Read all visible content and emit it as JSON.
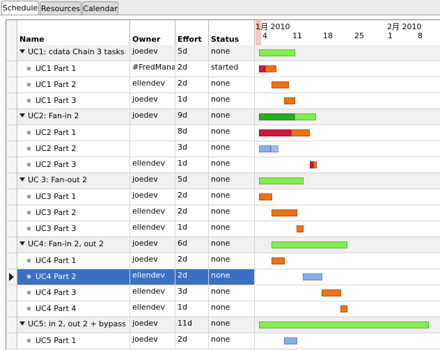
{
  "tabs": [
    {
      "label": "Schedule",
      "active": true
    },
    {
      "label": "Resources",
      "active": false
    },
    {
      "label": "Calendar",
      "active": false
    }
  ],
  "columns": {
    "name": "Name",
    "owner": "Owner",
    "effort": "Effort",
    "status": "Status"
  },
  "timeline": {
    "month1": "1月 2010",
    "month2": "2月 2010",
    "days": [
      "4",
      "11",
      "18",
      "25",
      "1",
      "8"
    ]
  },
  "colors": {
    "summary": "#7ff04a",
    "summary_done": "#22b022",
    "todo": "#ef7113",
    "done": "#d3173f",
    "idle": "#8aaeee",
    "selection": "#3a6fc4"
  },
  "rows": [
    {
      "name": "UC1: cdata Chain 3 tasks",
      "owner": "joedev",
      "effort": "5d",
      "status": "none",
      "parent": true
    },
    {
      "name": "UC1 Part 1",
      "owner": "#FredManager",
      "effort": "2d",
      "status": "started",
      "parent": false
    },
    {
      "name": "UC1 Part 2",
      "owner": "ellendev",
      "effort": "2d",
      "status": "none",
      "parent": false
    },
    {
      "name": "UC1 Part 3",
      "owner": "joedev",
      "effort": "1d",
      "status": "none",
      "parent": false
    },
    {
      "name": "UC2: Fan-in 2",
      "owner": "joedev",
      "effort": "9d",
      "status": "none",
      "parent": true
    },
    {
      "name": "UC2 Part 1",
      "owner": "",
      "effort": "8d",
      "status": "none",
      "parent": false
    },
    {
      "name": "UC2 Part 2",
      "owner": "",
      "effort": "3d",
      "status": "none",
      "parent": false
    },
    {
      "name": "UC2 Part 3",
      "owner": "ellendev",
      "effort": "1d",
      "status": "none",
      "parent": false
    },
    {
      "name": "UC 3: Fan-out 2",
      "owner": "joedev",
      "effort": "5d",
      "status": "none",
      "parent": true
    },
    {
      "name": "UC3 Part 1",
      "owner": "joedev",
      "effort": "2d",
      "status": "none",
      "parent": false
    },
    {
      "name": "UC3 Part 2",
      "owner": "ellendev",
      "effort": "2d",
      "status": "none",
      "parent": false
    },
    {
      "name": "UC3 Part 3",
      "owner": "ellendev",
      "effort": "1d",
      "status": "none",
      "parent": false
    },
    {
      "name": "UC4: Fan-in 2, out 2",
      "owner": "joedev",
      "effort": "6d",
      "status": "none",
      "parent": true
    },
    {
      "name": "UC4 Part 1",
      "owner": "joedev",
      "effort": "2d",
      "status": "none",
      "parent": false
    },
    {
      "name": "UC4 Part 2",
      "owner": "ellendev",
      "effort": "2d",
      "status": "none",
      "parent": false,
      "selected": true
    },
    {
      "name": "UC4 Part 3",
      "owner": "ellendev",
      "effort": "3d",
      "status": "none",
      "parent": false
    },
    {
      "name": "UC4 Part 4",
      "owner": "ellendev",
      "effort": "1d",
      "status": "none",
      "parent": false
    },
    {
      "name": "UC5: in 2, out 2 + bypass",
      "owner": "joedev",
      "effort": "11d",
      "status": "none",
      "parent": true
    },
    {
      "name": "UC5 Part 1",
      "owner": "joedev",
      "effort": "2d",
      "status": "none",
      "parent": false
    }
  ]
}
